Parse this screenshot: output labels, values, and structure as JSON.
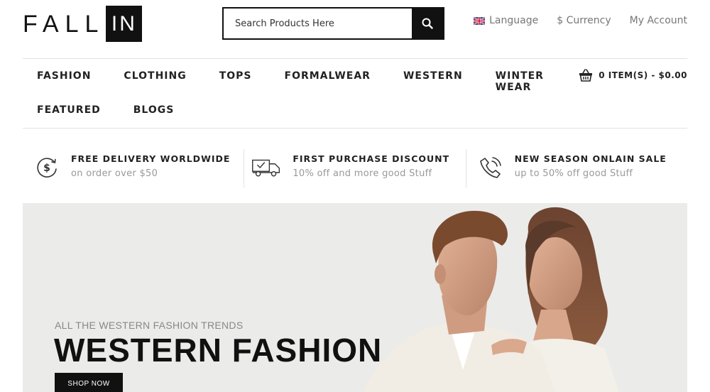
{
  "logo": {
    "part1": "FALL",
    "part2": "IN"
  },
  "search": {
    "placeholder": "Search Products Here"
  },
  "topnav": {
    "language": "Language",
    "currency": "$ Currency",
    "account": "My Account"
  },
  "menu": {
    "row1": [
      "FASHION",
      "CLOTHING",
      "TOPS",
      "FORMALWEAR",
      "WESTERN",
      "WINTER WEAR"
    ],
    "row2": [
      "FEATURED",
      "BLOGS"
    ]
  },
  "cart": {
    "label": "0 ITEM(S) - $0.00"
  },
  "features": [
    {
      "icon": "dollar-cycle-icon",
      "title": "FREE DELIVERY WORLDWIDE",
      "subtitle": "on order over $50"
    },
    {
      "icon": "delivery-truck-icon",
      "title": "FIRST PURCHASE DISCOUNT",
      "subtitle": "10% off and more good Stuff"
    },
    {
      "icon": "phone-call-icon",
      "title": "NEW SEASON ONLAIN SALE",
      "subtitle": "up to 50% off good Stuff"
    }
  ],
  "hero": {
    "subtitle": "ALL THE WESTERN FASHION TRENDS",
    "title": "WESTERN FASHION",
    "button": "SHOP NOW"
  },
  "colors": {
    "primary": "#111111",
    "muted": "#999999",
    "hero_bg": "#ebebe9"
  }
}
